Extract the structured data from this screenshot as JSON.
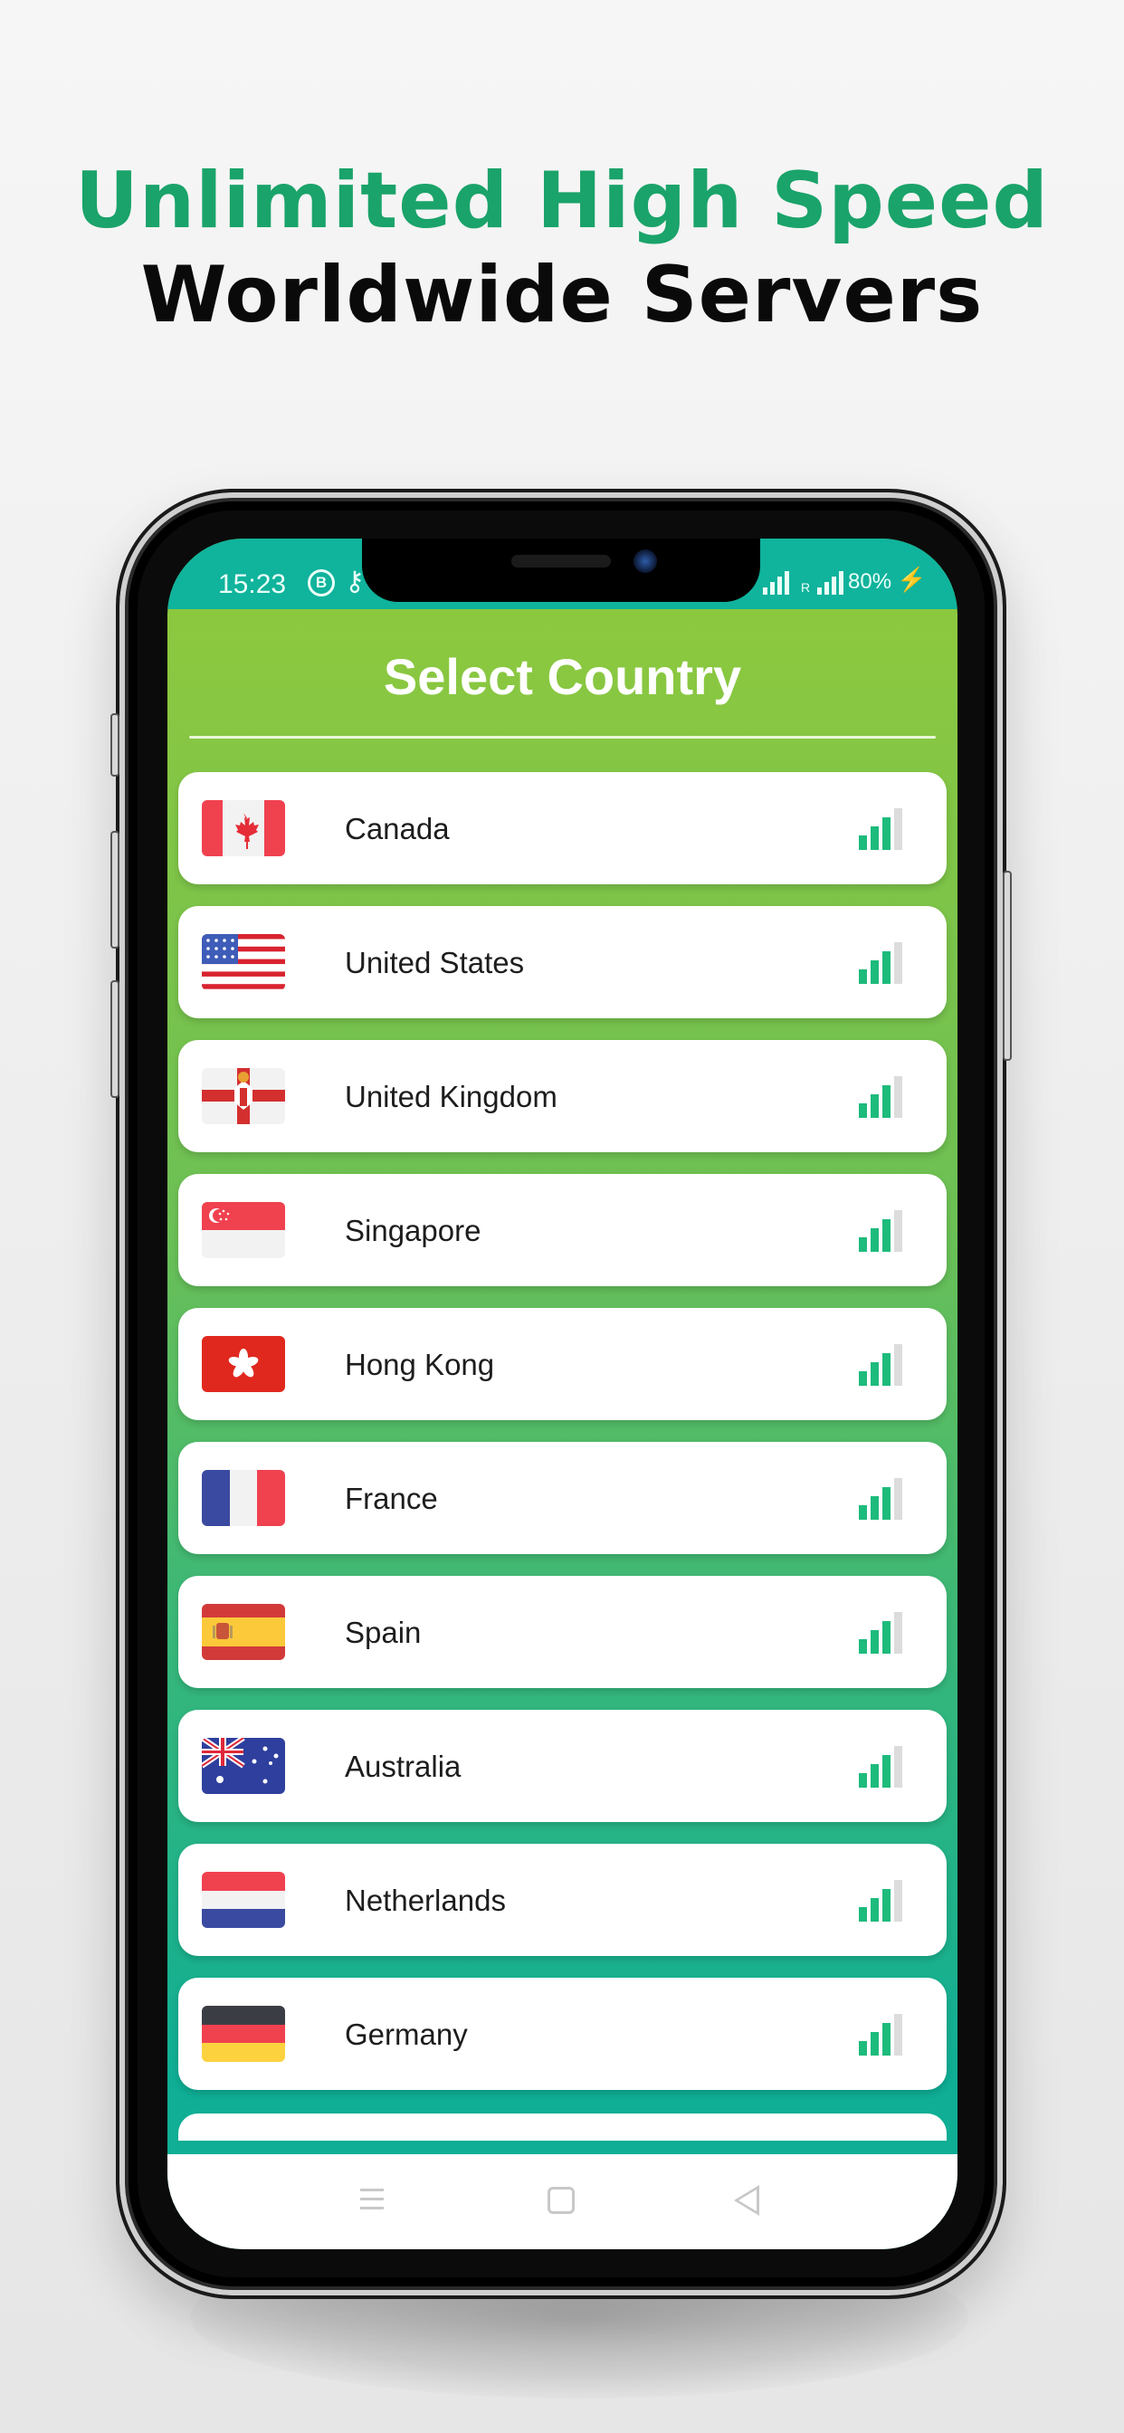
{
  "headline": {
    "line1": "Unlimited High Speed",
    "line2": "Worldwide Servers",
    "accent_color": "#1aa36a"
  },
  "status_bar": {
    "time": "15:23",
    "icons": [
      "business-chat-icon",
      "vpn-key-icon",
      "signal-icon",
      "signal-roaming-icon",
      "charging-icon"
    ],
    "battery": "80%",
    "roaming_label": "R"
  },
  "screen": {
    "title": "Select Country",
    "countries": [
      {
        "name": "Canada",
        "flag": "canada-flag",
        "signal_bars": 3,
        "signal_max": 4
      },
      {
        "name": "United States",
        "flag": "united-states-flag",
        "signal_bars": 3,
        "signal_max": 4
      },
      {
        "name": "United Kingdom",
        "flag": "northern-ireland-flag",
        "signal_bars": 3,
        "signal_max": 4
      },
      {
        "name": "Singapore",
        "flag": "singapore-flag",
        "signal_bars": 3,
        "signal_max": 4
      },
      {
        "name": "Hong Kong",
        "flag": "hong-kong-flag",
        "signal_bars": 3,
        "signal_max": 4
      },
      {
        "name": "France",
        "flag": "france-flag",
        "signal_bars": 3,
        "signal_max": 4
      },
      {
        "name": "Spain",
        "flag": "spain-flag",
        "signal_bars": 3,
        "signal_max": 4
      },
      {
        "name": "Australia",
        "flag": "australia-flag",
        "signal_bars": 3,
        "signal_max": 4
      },
      {
        "name": "Netherlands",
        "flag": "netherlands-flag",
        "signal_bars": 3,
        "signal_max": 4
      },
      {
        "name": "Germany",
        "flag": "germany-flag",
        "signal_bars": 3,
        "signal_max": 4
      }
    ],
    "signal_color": "#1dbb7c",
    "signal_empty_color": "#dcdcdc"
  },
  "nav_bar": {
    "buttons": [
      "menu",
      "home",
      "back"
    ]
  }
}
